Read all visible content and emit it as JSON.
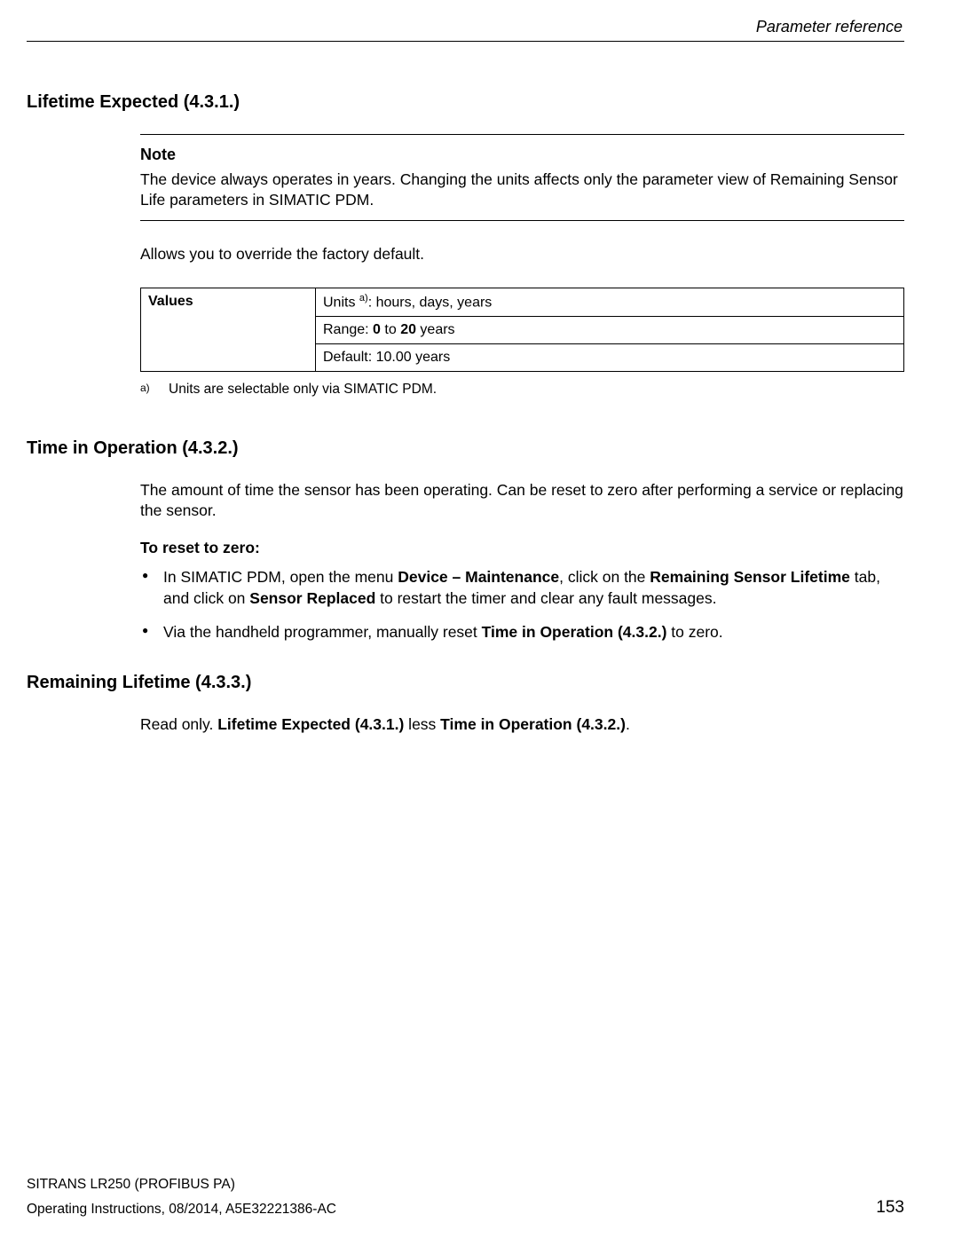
{
  "header": {
    "right": "Parameter reference"
  },
  "sections": {
    "s1": {
      "title": "Lifetime Expected (4.3.1.)",
      "note_label": "Note",
      "note_text": "The device always operates in years. Changing the units affects only the parameter view of Remaining Sensor Life parameters in SIMATIC PDM.",
      "para1": "Allows you to override the factory default.",
      "table_header": "Values",
      "row1_pre": "Units ",
      "row1_sup": "a)",
      "row1_post": ": hours, days, years",
      "row2_pre": "Range: ",
      "row2_b1": "0",
      "row2_mid": " to ",
      "row2_b2": "20",
      "row2_post": " years",
      "row3": "Default: 10.00 years",
      "fn_marker": "a)",
      "fn_text": "Units are selectable only via SIMATIC PDM."
    },
    "s2": {
      "title": "Time in Operation (4.3.2.)",
      "para": "The amount of time the sensor has been operating. Can be reset to zero after performing a service or replacing the sensor.",
      "subhead": "To reset to zero:",
      "b1_t1": "In SIMATIC PDM, open the menu ",
      "b1_b1": "Device – Maintenance",
      "b1_t2": ", click on the ",
      "b1_b2": "Remaining Sensor Lifetime",
      "b1_t3": " tab, and click on ",
      "b1_b3": "Sensor Replaced",
      "b1_t4": " to restart the timer and clear any fault messages.",
      "b2_t1": "Via the handheld programmer, manually reset ",
      "b2_b1": "Time in Operation (4.3.2.)",
      "b2_t2": " to zero."
    },
    "s3": {
      "title": "Remaining Lifetime (4.3.3.)",
      "t1": "Read only. ",
      "b1": "Lifetime Expected (4.3.1.)",
      "t2": " less ",
      "b2": "Time in Operation (4.3.2.)",
      "t3": "."
    }
  },
  "footer": {
    "line1": "SITRANS LR250 (PROFIBUS PA)",
    "line2": "Operating Instructions, 08/2014, A5E32221386-AC",
    "page": "153"
  }
}
